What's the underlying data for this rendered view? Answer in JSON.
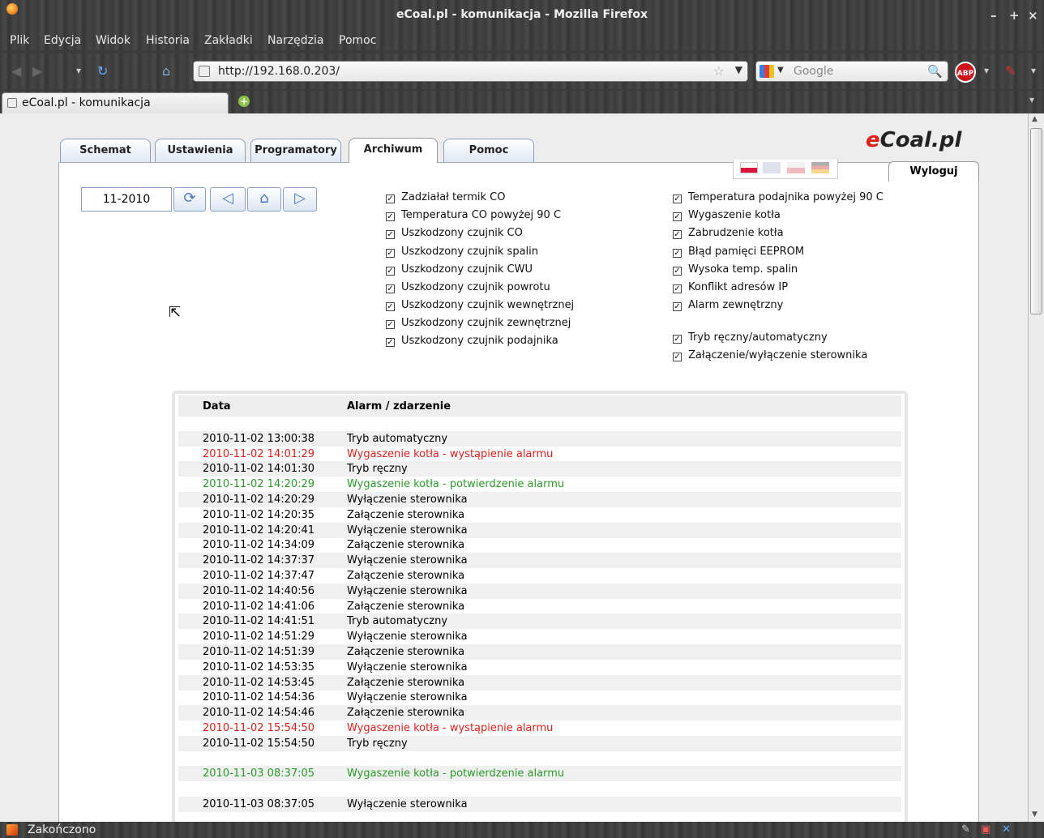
{
  "window": {
    "title": "eCoal.pl - komunikacja - Mozilla Firefox",
    "controls": [
      "–",
      "+",
      "×"
    ]
  },
  "menu": [
    "Plik",
    "Edycja",
    "Widok",
    "Historia",
    "Zakładki",
    "Narzędzia",
    "Pomoc"
  ],
  "url": "http://192.168.0.203/",
  "search": {
    "placeholder": "Google"
  },
  "browser_tab": {
    "label": "eCoal.pl - komunikacja"
  },
  "abp_label": "ABP",
  "logo": {
    "e": "e",
    "rest": "Coal.pl"
  },
  "site_tabs": [
    "Schemat",
    "Ustawienia",
    "Programatory",
    "Archiwum",
    "Pomoc"
  ],
  "active_tab": "Archiwum",
  "logout": "Wyloguj",
  "month": "11-2010",
  "checks_left": [
    "Zadziałał termik CO",
    "Temperatura CO powyżej 90 C",
    "Uszkodzony czujnik CO",
    "Uszkodzony czujnik spalin",
    "Uszkodzony czujnik CWU",
    "Uszkodzony czujnik powrotu",
    "Uszkodzony czujnik wewnętrznej",
    "Uszkodzony czujnik zewnętrznej",
    "Uszkodzony czujnik podajnika"
  ],
  "checks_right": [
    "Temperatura podajnika powyżej 90 C",
    "Wygaszenie kotła",
    "Zabrudzenie kotła",
    "Błąd pamięci EEPROM",
    "Wysoka temp. spalin",
    "Konflikt adresów IP",
    "Alarm zewnętrzny"
  ],
  "checks_right2": [
    "Tryb ręczny/automatyczny",
    "Załączenie/wyłączenie sterownika"
  ],
  "table": {
    "headers": [
      "Data",
      "Alarm / zdarzenie"
    ],
    "rows": [
      {
        "date": "",
        "event": "",
        "color": ""
      },
      {
        "date": "2010-11-02 13:00:38",
        "event": "Tryb automatyczny",
        "color": ""
      },
      {
        "date": "2010-11-02 14:01:29",
        "event": "Wygaszenie kotła - wystąpienie alarmu",
        "color": "red"
      },
      {
        "date": "2010-11-02 14:01:30",
        "event": "Tryb ręczny",
        "color": ""
      },
      {
        "date": "2010-11-02 14:20:29",
        "event": "Wygaszenie kotła - potwierdzenie alarmu",
        "color": "green"
      },
      {
        "date": "2010-11-02 14:20:29",
        "event": "Wyłączenie sterownika",
        "color": ""
      },
      {
        "date": "2010-11-02 14:20:35",
        "event": "Załączenie sterownika",
        "color": ""
      },
      {
        "date": "2010-11-02 14:20:41",
        "event": "Wyłączenie sterownika",
        "color": ""
      },
      {
        "date": "2010-11-02 14:34:09",
        "event": "Załączenie sterownika",
        "color": ""
      },
      {
        "date": "2010-11-02 14:37:37",
        "event": "Wyłączenie sterownika",
        "color": ""
      },
      {
        "date": "2010-11-02 14:37:47",
        "event": "Załączenie sterownika",
        "color": ""
      },
      {
        "date": "2010-11-02 14:40:56",
        "event": "Wyłączenie sterownika",
        "color": ""
      },
      {
        "date": "2010-11-02 14:41:06",
        "event": "Załączenie sterownika",
        "color": ""
      },
      {
        "date": "2010-11-02 14:41:51",
        "event": "Tryb automatyczny",
        "color": ""
      },
      {
        "date": "2010-11-02 14:51:29",
        "event": "Wyłączenie sterownika",
        "color": ""
      },
      {
        "date": "2010-11-02 14:51:39",
        "event": "Załączenie sterownika",
        "color": ""
      },
      {
        "date": "2010-11-02 14:53:35",
        "event": "Wyłączenie sterownika",
        "color": ""
      },
      {
        "date": "2010-11-02 14:53:45",
        "event": "Załączenie sterownika",
        "color": ""
      },
      {
        "date": "2010-11-02 14:54:36",
        "event": "Wyłączenie sterownika",
        "color": ""
      },
      {
        "date": "2010-11-02 14:54:46",
        "event": "Załączenie sterownika",
        "color": ""
      },
      {
        "date": "2010-11-02 15:54:50",
        "event": "Wygaszenie kotła - wystąpienie alarmu",
        "color": "red"
      },
      {
        "date": "2010-11-02 15:54:50",
        "event": "Tryb ręczny",
        "color": ""
      },
      {
        "date": "",
        "event": "",
        "color": ""
      },
      {
        "date": "2010-11-03 08:37:05",
        "event": "Wygaszenie kotła - potwierdzenie alarmu",
        "color": "green"
      },
      {
        "date": "",
        "event": "",
        "color": ""
      },
      {
        "date": "2010-11-03 08:37:05",
        "event": "Wyłączenie sterownika",
        "color": ""
      }
    ]
  },
  "status": "Zakończono",
  "colors": {
    "accent_red": "#e0201a",
    "ok_green": "#2a9a2a",
    "tab_border": "#8a9fbf"
  }
}
